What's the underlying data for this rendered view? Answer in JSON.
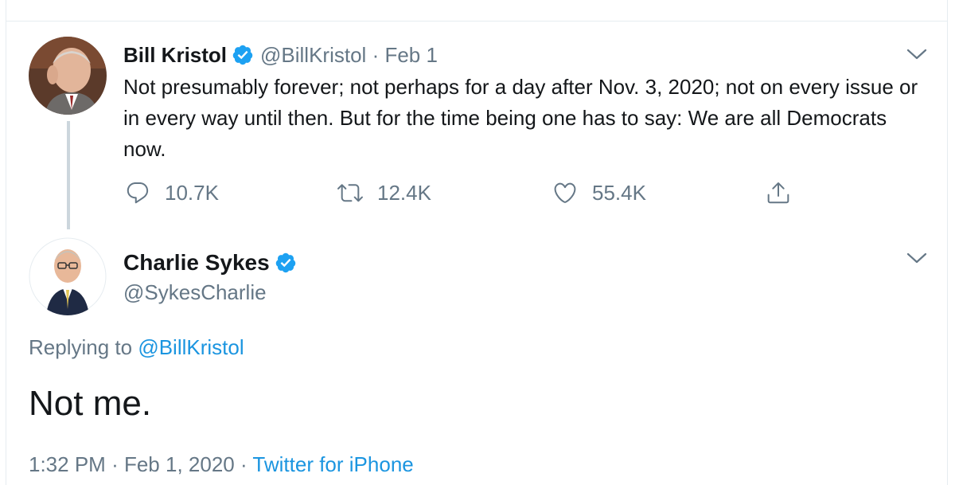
{
  "colors": {
    "accent": "#1b95e0",
    "secondary_text": "#657786",
    "primary_text": "#14171a",
    "thread_line": "#ccd6dd"
  },
  "tweet1": {
    "author_name": "Bill Kristol",
    "author_handle": "@BillKristol",
    "separator": "·",
    "date": "Feb 1",
    "verified_icon": "verified-badge-icon",
    "text": "Not presumably forever; not perhaps for a day after Nov. 3, 2020; not on every issue or in every way until then. But for the time being one has to say: We are all Democrats now.",
    "actions": {
      "reply_icon": "reply-icon",
      "reply_count": "10.7K",
      "retweet_icon": "retweet-icon",
      "retweet_count": "12.4K",
      "like_icon": "heart-icon",
      "like_count": "55.4K",
      "share_icon": "share-icon"
    }
  },
  "tweet2": {
    "author_name": "Charlie Sykes",
    "author_handle": "@SykesCharlie",
    "verified_icon": "verified-badge-icon",
    "replying_to_label": "Replying to",
    "replying_to_handle": "@BillKristol",
    "text": "Not me.",
    "time": "1:32 PM",
    "separator": "·",
    "date": "Feb 1, 2020",
    "separator2": "·",
    "source": "Twitter for iPhone"
  }
}
